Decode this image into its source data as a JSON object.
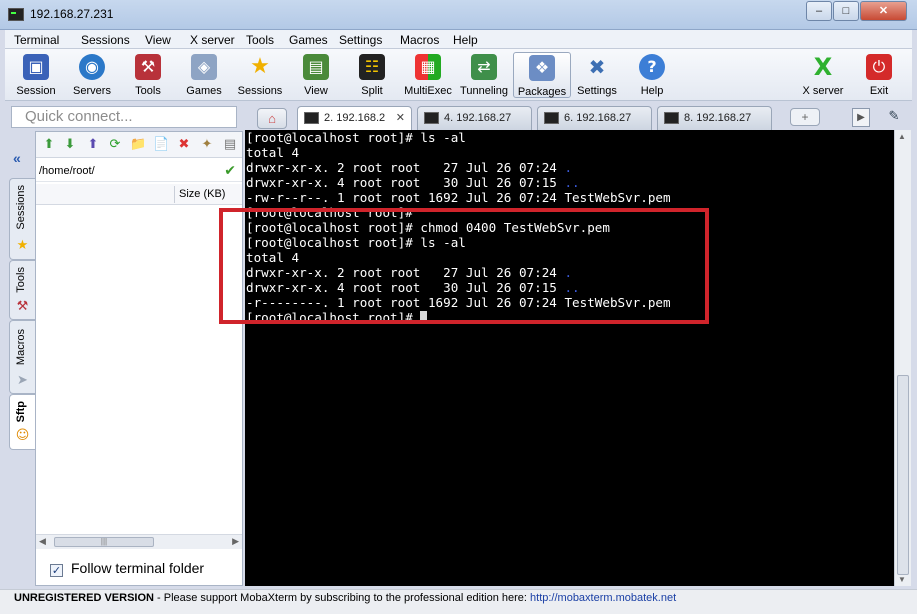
{
  "window": {
    "title": "192.168.27.231"
  },
  "menu": [
    "Terminal",
    "Sessions",
    "View",
    "X server",
    "Tools",
    "Games",
    "Settings",
    "Macros",
    "Help"
  ],
  "toolbar": {
    "buttons": [
      {
        "label": "Session",
        "icon": "session-icon"
      },
      {
        "label": "Servers",
        "icon": "servers-icon"
      },
      {
        "label": "Tools",
        "icon": "tools-icon"
      },
      {
        "label": "Games",
        "icon": "games-icon"
      },
      {
        "label": "Sessions",
        "icon": "star-icon"
      },
      {
        "label": "View",
        "icon": "view-icon"
      },
      {
        "label": "Split",
        "icon": "split-icon"
      },
      {
        "label": "MultiExec",
        "icon": "multiexec-icon"
      },
      {
        "label": "Tunneling",
        "icon": "tunneling-icon"
      },
      {
        "label": "Packages",
        "icon": "packages-icon"
      },
      {
        "label": "Settings",
        "icon": "settings-icon"
      },
      {
        "label": "Help",
        "icon": "help-icon"
      }
    ],
    "xserver": "X server",
    "exit": "Exit"
  },
  "quick_connect": {
    "placeholder": "Quick connect..."
  },
  "tabs": [
    {
      "label": "2. 192.168.2"
    },
    {
      "label": "4. 192.168.27"
    },
    {
      "label": "6. 192.168.27"
    },
    {
      "label": "8. 192.168.27"
    }
  ],
  "sidebar_tabs": [
    "Sessions",
    "Tools",
    "Macros",
    "Sftp"
  ],
  "sftp": {
    "path": "/home/root/",
    "column_size": "Size (KB)",
    "follow_label": "Follow terminal folder"
  },
  "terminal": {
    "lines": [
      "[root@localhost root]# ls -al",
      "total 4",
      "drwxr-xr-x. 2 root root   27 Jul 26 07:24 .",
      "drwxr-xr-x. 4 root root   30 Jul 26 07:15 ..",
      "-rw-r--r--. 1 root root 1692 Jul 26 07:24 TestWebSvr.pem",
      "[root@localhost root]#",
      "[root@localhost root]# chmod 0400 TestWebSvr.pem",
      "[root@localhost root]# ls -al",
      "total 4",
      "drwxr-xr-x. 2 root root   27 Jul 26 07:24 .",
      "drwxr-xr-x. 4 root root   30 Jul 26 07:15 ..",
      "-r--------. 1 root root 1692 Jul 26 07:24 TestWebSvr.pem",
      "[root@localhost root]# "
    ]
  },
  "status": {
    "unregistered": "UNREGISTERED VERSION",
    "message": "  -  Please support MobaXterm by subscribing to the professional edition here:  ",
    "link": "http://mobaxterm.mobatek.net"
  },
  "colors": {
    "highlight": "#d0242b",
    "terminal_bg": "#000000",
    "dir_dot": "#3b5bdb"
  }
}
